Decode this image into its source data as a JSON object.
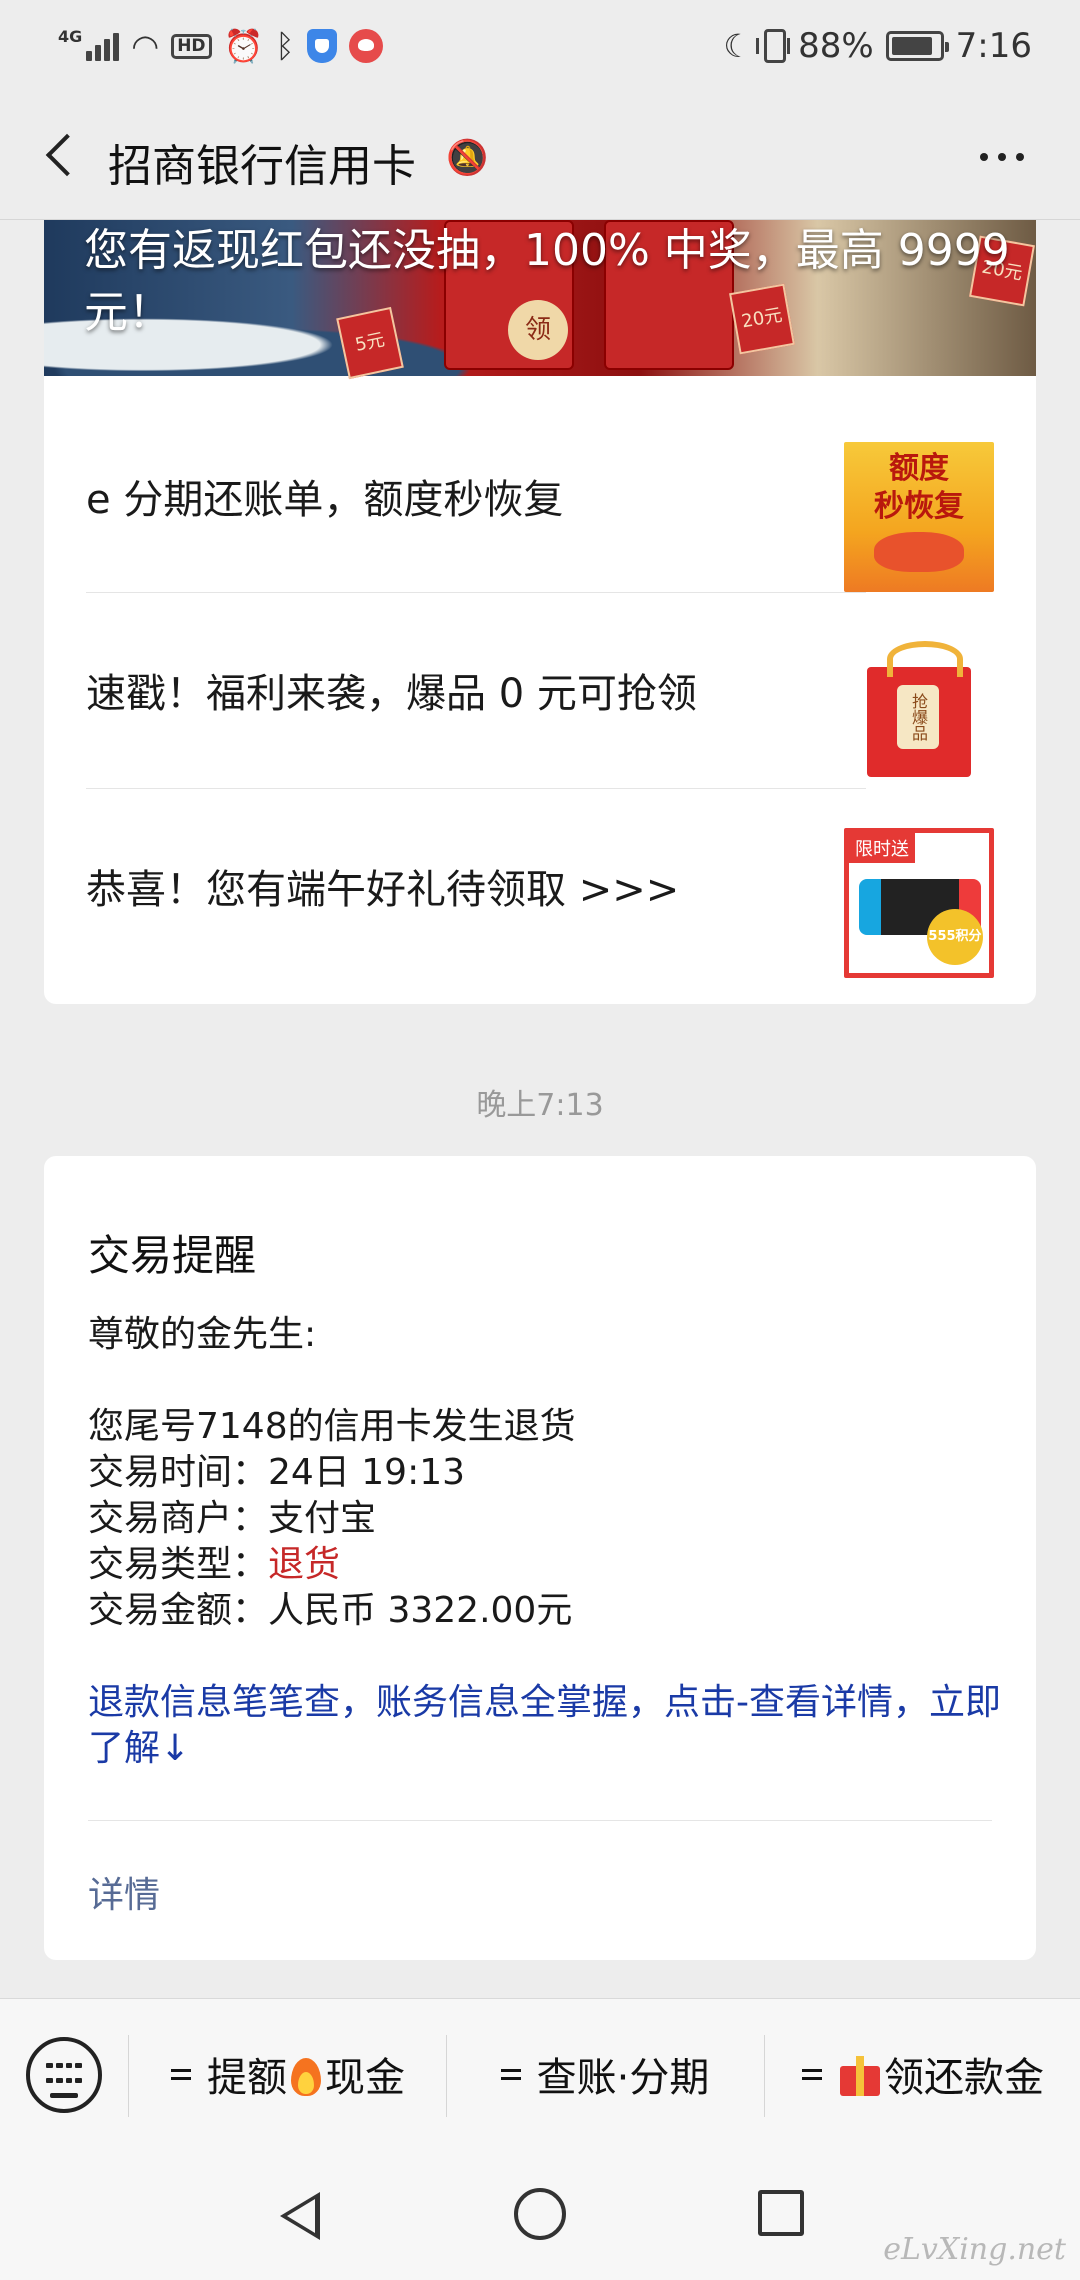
{
  "status_bar": {
    "network": "4G",
    "hd": "HD",
    "battery": "88%",
    "battery_level": 0.88,
    "time": "7:16"
  },
  "header": {
    "title": "招商银行信用卡",
    "mute_icon": "bell-off-icon",
    "more_icon": "more-icon"
  },
  "news": {
    "banner_text": "您有返现红包还没抽，100% 中奖，最高 9999 元！",
    "banner_deco": {
      "big_number": "9999",
      "coin": "领",
      "tag1": "5元",
      "tag2": "20元",
      "tag3": "20元"
    },
    "items": [
      {
        "text": "e 分期还账单，额度秒恢复",
        "thumb_text_1": "额度",
        "thumb_text_2": "秒恢复"
      },
      {
        "text": "速戳！福利来袭，爆品 0 元可抢领",
        "thumb_text_1": "抢爆品"
      },
      {
        "text": "恭喜！您有端午好礼待领取 >>>",
        "thumb_text_1": "限时送",
        "thumb_text_2": "555积分"
      }
    ]
  },
  "timestamp": "晚上7:13",
  "transaction": {
    "title": "交易提醒",
    "greeting": "尊敬的金先生:",
    "line1": "您尾号7148的信用卡发生退货",
    "time_label": "交易时间：",
    "time_value": "24日 19:13",
    "merchant_label": "交易商户：",
    "merchant_value": "支付宝",
    "type_label": "交易类型：",
    "type_value": "退货",
    "amount_label": "交易金额：",
    "amount_value": "人民币 3322.00元",
    "link_text": "退款信息笔笔查，账务信息全掌握，点击-查看详情，立即了解↓",
    "detail": "详情"
  },
  "menu": {
    "keyboard_icon": "keyboard-icon",
    "item1_a": "提额",
    "item1_b": "现金",
    "item2": "查账·分期",
    "item3": "领还款金"
  },
  "watermark": "eLvXing.net",
  "colors": {
    "accent_link": "#1a3aa6",
    "detail_link": "#576b95",
    "alert_red": "#c62828",
    "background": "#ededed"
  }
}
